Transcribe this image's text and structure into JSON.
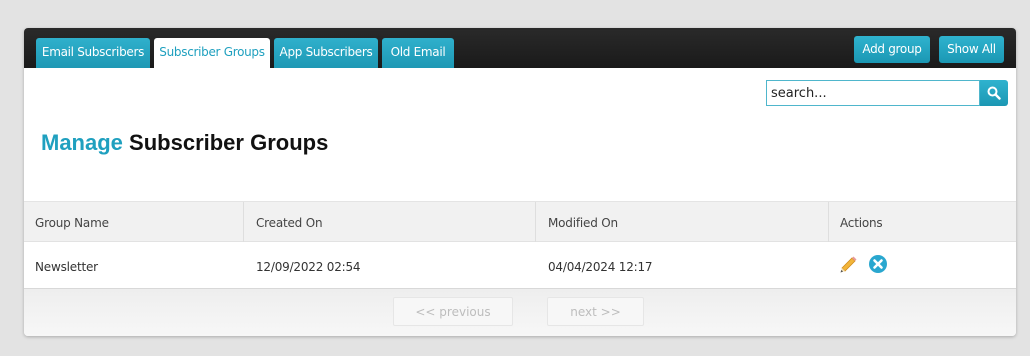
{
  "tabs": [
    {
      "label": "Email Subscribers",
      "active": false
    },
    {
      "label": "Subscriber Groups",
      "active": true
    },
    {
      "label": "App Subscribers",
      "active": false
    },
    {
      "label": "Old Email",
      "active": false
    }
  ],
  "toolbar": {
    "add_group_label": "Add group",
    "show_all_label": "Show All"
  },
  "search": {
    "value": "search...",
    "button_icon": "search-icon"
  },
  "page_title": {
    "accent": "Manage",
    "rest": "Subscriber Groups"
  },
  "table": {
    "columns": [
      "Group Name",
      "Created On",
      "Modified On",
      "Actions"
    ],
    "rows": [
      {
        "group_name": "Newsletter",
        "created_on": "12/09/2022 02:54",
        "modified_on": "04/04/2024 12:17",
        "actions": [
          "edit-icon",
          "delete-icon"
        ]
      }
    ]
  },
  "pagination": {
    "previous_label": "<< previous",
    "next_label": "next >>"
  },
  "colors": {
    "accent": "#1fa0bf",
    "topbar": "#1e1e1e"
  }
}
